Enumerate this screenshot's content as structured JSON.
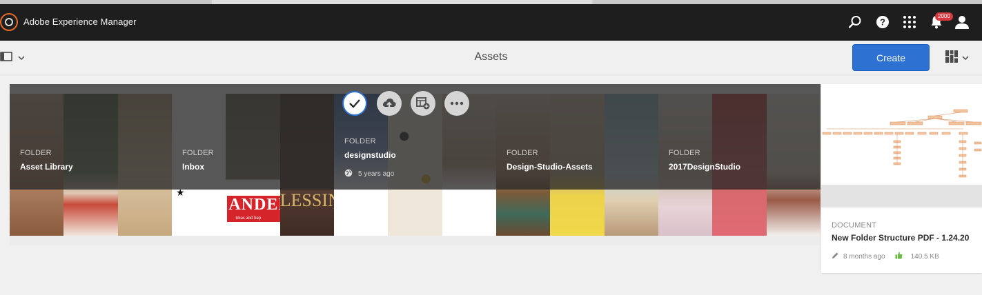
{
  "app": {
    "title": "Adobe Experience Manager",
    "notification_count": "2000"
  },
  "shell_icons": [
    "search-icon",
    "help-icon",
    "solutions-grid-icon",
    "notifications-bell-icon",
    "user-avatar-icon"
  ],
  "actionbar": {
    "page_title": "Assets",
    "create_label": "Create"
  },
  "cards": [
    {
      "type": "FOLDER",
      "name": "Asset Library"
    },
    {
      "type": "FOLDER",
      "name": "Inbox",
      "thumb_text": "ANDER",
      "thumb_subtext": "tmas and hap",
      "thumb_text2": "LESSIN"
    },
    {
      "type": "FOLDER",
      "name": "designstudio",
      "modified": "5 years ago",
      "selected": true
    },
    {
      "type": "FOLDER",
      "name": "Design-Studio-Assets"
    },
    {
      "type": "FOLDER",
      "name": "2017DesignStudio"
    }
  ],
  "quick_actions": [
    "select-check-icon",
    "upload-cloud-icon",
    "add-to-collection-icon",
    "more-actions-icon"
  ],
  "document_card": {
    "type": "DOCUMENT",
    "name": "New Folder Structure PDF - 1.24.20",
    "modified": "8 months ago",
    "size": "140.5 KB"
  },
  "colors": {
    "brand": "#2d72d2",
    "shell": "#1e1e1e",
    "badge": "#d7373f"
  }
}
